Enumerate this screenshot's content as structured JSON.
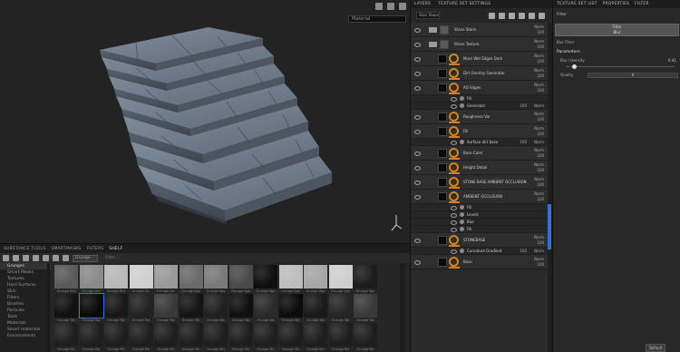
{
  "viewport": {
    "view_select": "Material"
  },
  "shelf": {
    "tabs": [
      "SUBSTANCE TOOLS",
      "SMARTMASKS",
      "FILTERS",
      "SHELF"
    ],
    "search_chip": "Grunge",
    "filter_text": "Filter...",
    "categories": [
      "Grunges",
      "Smart Masks",
      "Textures",
      "Hard Surfaces",
      "Skin",
      "Filters",
      "Brushes",
      "Particles",
      "Tools",
      "Materials",
      "Smart materials",
      "Environments"
    ],
    "selected_category": 0,
    "thumb_labels": [
      "Grunge Dirt",
      "Grunge Dirt",
      "Grunge Dirt",
      "Grunge Scr",
      "Grunge Scr",
      "Grunge Spo",
      "Grunge Spo",
      "Grunge Spo",
      "Grunge Spo",
      "Grunge Spo",
      "Grunge Spo",
      "Grunge Spo",
      "Grunge Spo",
      "Grunge Tex",
      "Grunge Tex",
      "Grunge Tex",
      "Grunge Tex",
      "Grunge Tex",
      "Grunge Tex",
      "Grunge Wo",
      "Grunge Wo",
      "Grunge Wo",
      "Grunge Wo",
      "Grunge Wo",
      "Grunge Wo",
      "Grunge Wo",
      "Grunge Mu",
      "Grunge Mu",
      "Grunge Mu",
      "Grunge Mu",
      "Grunge Mu",
      "Grunge Mu",
      "Grunge Mu",
      "Grunge Mu",
      "Grunge Mu",
      "Grunge Mu",
      "Grunge Mu",
      "Grunge Mu",
      "Grunge Mu"
    ]
  },
  "layers": {
    "tabs": [
      "LAYERS",
      "TEXTURE SET SETTINGS"
    ],
    "texture_set": "Stair Steps",
    "rows": [
      {
        "name": "Stone Stairs",
        "type": "folder",
        "blend": "Norm",
        "opacity": "100"
      },
      {
        "name": "Stone Texture",
        "type": "folder",
        "blend": "Norm",
        "opacity": "100"
      },
      {
        "name": "Moss Wet Edges Dark",
        "type": "fill",
        "blend": "Norm",
        "opacity": "100"
      },
      {
        "name": "Dirt Overlay Generator",
        "type": "fill",
        "blend": "Norm",
        "opacity": "100"
      },
      {
        "name": "AO Edges",
        "type": "fill",
        "blend": "Norm",
        "opacity": "100"
      },
      {
        "name": "Fill",
        "type": "sub",
        "blend": "",
        "opacity": ""
      },
      {
        "name": "Generator",
        "type": "sub",
        "blend": "Norm",
        "opacity": "100"
      },
      {
        "name": "Roughness Var",
        "type": "fill",
        "blend": "Norm",
        "opacity": "100"
      },
      {
        "name": "Fill",
        "type": "fill",
        "blend": "Norm",
        "opacity": "100"
      },
      {
        "name": "Surface dirt base",
        "type": "sub",
        "blend": "Norm",
        "opacity": "100"
      },
      {
        "name": "Base Color",
        "type": "fill",
        "blend": "Norm",
        "opacity": "100"
      },
      {
        "name": "Height Detail",
        "type": "fill",
        "blend": "Norm",
        "opacity": "100"
      },
      {
        "name": "STONE BASE AMBIENT OCCLUSION",
        "type": "fill",
        "blend": "Norm",
        "opacity": "100"
      },
      {
        "name": "AMBIENT OCCLUSION",
        "type": "fill",
        "blend": "Norm",
        "opacity": "100"
      },
      {
        "name": "Fill",
        "type": "sub",
        "blend": "",
        "opacity": ""
      },
      {
        "name": "Levels",
        "type": "sub",
        "blend": "",
        "opacity": ""
      },
      {
        "name": "Blur",
        "type": "sub",
        "blend": "",
        "opacity": ""
      },
      {
        "name": "Fill",
        "type": "sub",
        "blend": "",
        "opacity": ""
      },
      {
        "name": "STONEBASE",
        "type": "fill",
        "blend": "Norm",
        "opacity": "100"
      },
      {
        "name": "Curvature Gradient",
        "type": "sub",
        "blend": "Norm",
        "opacity": "100"
      },
      {
        "name": "Base",
        "type": "fill",
        "blend": "Norm",
        "opacity": "100"
      }
    ]
  },
  "properties": {
    "tabs": [
      "TEXTURE SET LIST",
      "PROPERTIES",
      "FILTER"
    ],
    "subtitle": "Filter",
    "filter_name": "Filter",
    "filter_sub": "Blur",
    "line1": "Blur Filter",
    "params_header": "Parameters",
    "param1_label": "Blur Intensity",
    "param1_value": "0.41",
    "param2_label": "Quality",
    "param2_value": "0",
    "button": "Default"
  }
}
